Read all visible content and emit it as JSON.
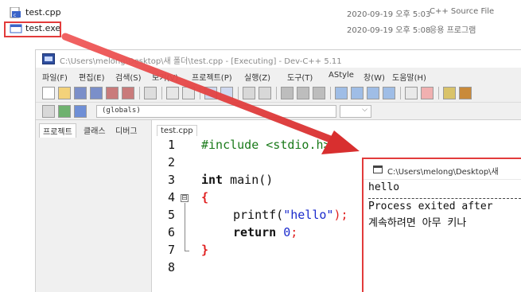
{
  "explorer": {
    "files": [
      {
        "name": "test.cpp",
        "date": "2020-09-19 오후 5:03",
        "type": "C++ Source File"
      },
      {
        "name": "test.exe",
        "date": "2020-09-19 오후 5:08",
        "type": "응용 프로그램"
      }
    ]
  },
  "ide": {
    "title": "C:\\Users\\melong\\Desktop\\새 폴더\\test.cpp - [Executing] - Dev-C++ 5.11",
    "menu": [
      "파일(F)",
      "편집(E)",
      "검색(S)",
      "보기(V)",
      "프로젝트(P)",
      "실행(Z)",
      "도구(T)",
      "AStyle",
      "창(W)",
      "도움말(H)"
    ],
    "scope": "(globals)",
    "panel_tabs": [
      "프로젝트",
      "클래스",
      "디버그"
    ],
    "editor_tab": "test.cpp",
    "line_numbers": [
      "1",
      "2",
      "3",
      "4",
      "5",
      "6",
      "7",
      "8"
    ],
    "code": {
      "line1_directive": "#include <stdio.h>",
      "line3_type": "int",
      "line3_rest": " main()",
      "line4_brace": "{",
      "line5_func": "printf(",
      "line5_str": "\"hello\"",
      "line5_end": ");",
      "line6_kw": "return",
      "line6_num": " 0",
      "line6_end": ";",
      "line7_brace": "}"
    },
    "fold_open": "⊟"
  },
  "console": {
    "title": "C:\\Users\\melong\\Desktop\\새",
    "output": [
      "hello",
      "Process exited after",
      "계속하려면 아무 키나"
    ]
  },
  "colors": {
    "highlight": "#e23b3b",
    "arrow": "#e23b3b",
    "string": "#1a2acc",
    "preprocessor": "#1a7a1a"
  }
}
